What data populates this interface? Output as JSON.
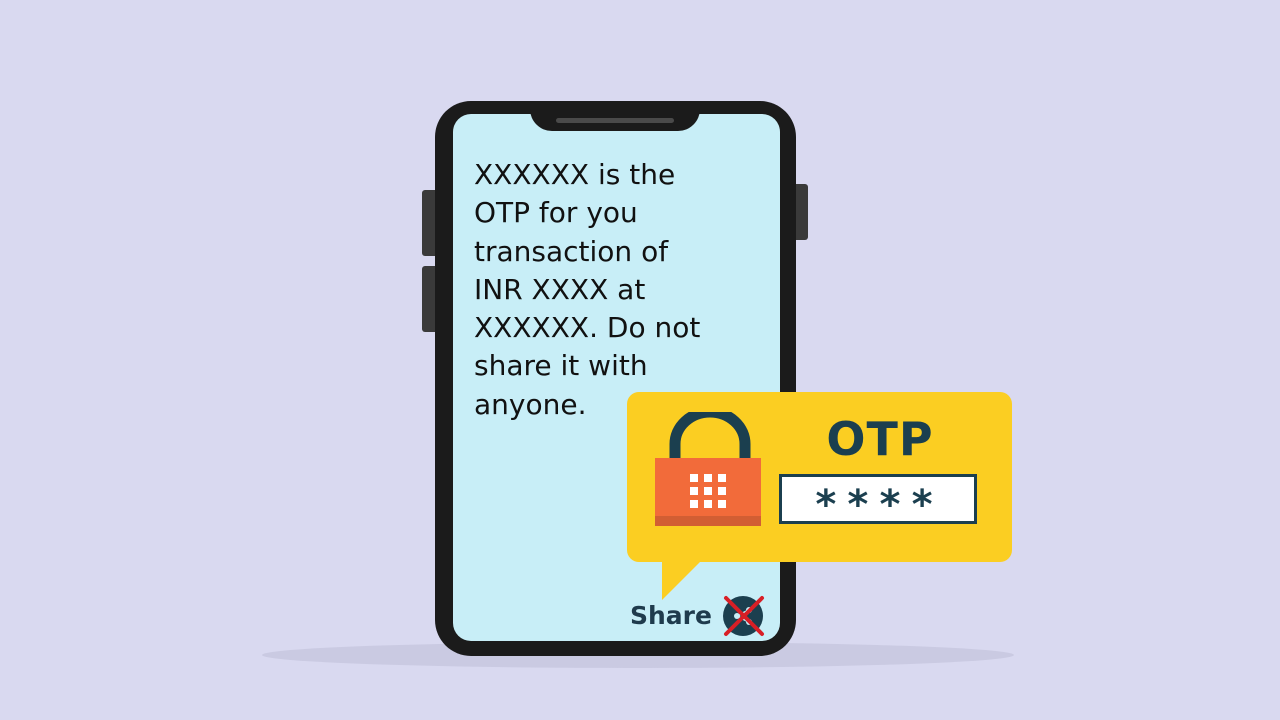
{
  "message": {
    "text": "XXXXXX is the\nOTP for you\ntransaction of\nINR XXXX at\nXXXXXX. Do not\nshare it with\nanyone."
  },
  "share": {
    "label": "Share",
    "icon": "share-blocked-icon"
  },
  "otp_card": {
    "title": "OTP",
    "masked_value": "****",
    "icon": "padlock-icon"
  },
  "colors": {
    "background": "#d9d9f0",
    "screen": "#c8eef7",
    "card": "#fbce22",
    "lock_body": "#f26b3a",
    "text_dark": "#1b3f4f",
    "cross": "#d81f26"
  }
}
